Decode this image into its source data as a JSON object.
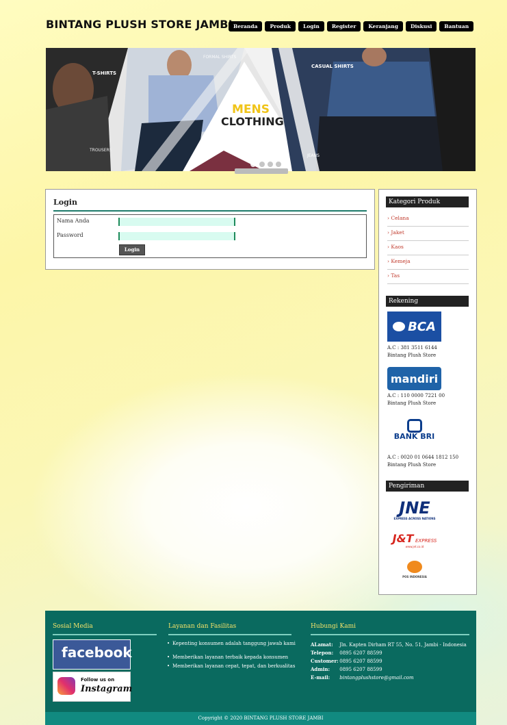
{
  "header": {
    "title": "BINTANG PLUSH STORE JAMBI",
    "nav": [
      "Beranda",
      "Produk",
      "Login",
      "Register",
      "Keranjang",
      "Diskusi",
      "Bantuan"
    ]
  },
  "banner": {
    "labels": {
      "tshirts": "T-SHIRTS",
      "formal": "FORMAL SHIRTS",
      "casual": "CASUAL SHIRTS",
      "mens": "MENS",
      "clothing": "CLOTHING",
      "trousers": "TROUSERS",
      "jeans": "JEANS"
    },
    "accent_color": "#f0c419"
  },
  "login": {
    "title": "Login",
    "name_label": "Nama Anda",
    "password_label": "Password",
    "name_value": "",
    "password_value": "",
    "button": "Login"
  },
  "sidebar": {
    "categories_title": "Kategori Produk",
    "categories": [
      "› Celana",
      "› Jaket",
      "› Kaos",
      "› Kemeja",
      "› Tas"
    ],
    "accounts_title": "Rekening",
    "accounts": [
      {
        "bank": "BCA",
        "number": "A.C : 381 3511 6144",
        "holder": "Bintang Plush Store"
      },
      {
        "bank": "mandiri",
        "number": "A.C : 110 0000 7221 00",
        "holder": "Bintang Plush Store"
      },
      {
        "bank": "BANK BRI",
        "number": "A.C : 0020 01 0644 1812 150",
        "holder": "Bintang Plush Store"
      }
    ],
    "shipping_title": "Pengiriman",
    "shipping": {
      "jne": "JNE",
      "jne_tag": "EXPRESS ACROSS NATIONS",
      "jnt": "J&T",
      "jnt_tag": "EXPRESS",
      "jnt_url": "www.jet.co.id",
      "pos": "POS INDONESIA"
    }
  },
  "footer": {
    "social_title": "Sosial Media",
    "facebook": "facebook",
    "instagram_follow": "Follow us on",
    "instagram": "Instagram",
    "services_title": "Layanan dan Fasilitas",
    "services": [
      "Kepenting konsumen adalah tanggung jawab kami",
      "Memberikan layanan terbaik kepada konsumen",
      "Memberikan layanan cepat, tepat, dan berkualitas"
    ],
    "contact_title": "Hubungi Kami",
    "contact": [
      {
        "label": "ALamat:",
        "value": "Jln. Kapten Dirham RT 55, No. 51, Jambi - Indonesia"
      },
      {
        "label": "Telepon:",
        "value": "0895 6207 88599"
      },
      {
        "label": "Customer:",
        "value": "0895 6207 88599"
      },
      {
        "label": "Admin:",
        "value": "0895 6207 88599"
      },
      {
        "label": "E-mail:",
        "value": "bintangplushstore@gmail.com"
      }
    ],
    "copyright": "Copyright © 2020 BINTANG PLUSH STORE JAMBI"
  }
}
